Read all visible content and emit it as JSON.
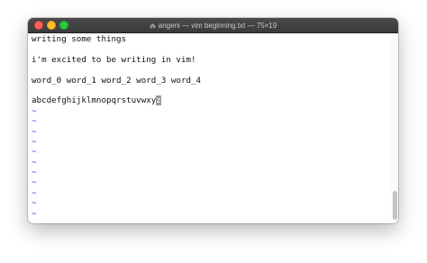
{
  "window": {
    "title": "angeni — vim beginning.txt — 75×19"
  },
  "editor": {
    "lines": [
      "writing some things",
      "",
      "i'm excited to be writing in vim!",
      "",
      "word_0 word_1 word_2 word_3 word_4",
      "",
      "abcdefghijklmnopqrstuvwxy"
    ],
    "cursor_char": "z",
    "tilde": "~",
    "tilde_count": 11
  }
}
